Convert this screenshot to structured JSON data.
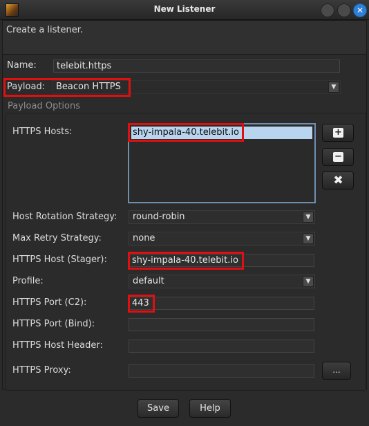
{
  "window": {
    "title": "New Listener",
    "close_glyph": "✕"
  },
  "header": {
    "description": "Create a listener."
  },
  "form": {
    "name_label": "Name:",
    "name_value": "telebit.https",
    "payload_label": "Payload:",
    "payload_value": "Beacon HTTPS",
    "dropdown_glyph": "▼"
  },
  "options": {
    "group_title": "Payload Options",
    "https_hosts_label": "HTTPS Hosts:",
    "https_hosts": [
      "shy-impala-40.telebit.io"
    ],
    "add_glyph": "+",
    "remove_glyph": "−",
    "clear_glyph": "✖",
    "host_rotation_label": "Host Rotation Strategy:",
    "host_rotation_value": "round-robin",
    "max_retry_label": "Max Retry Strategy:",
    "max_retry_value": "none",
    "stager_label": "HTTPS Host (Stager):",
    "stager_value": "shy-impala-40.telebit.io",
    "profile_label": "Profile:",
    "profile_value": "default",
    "port_c2_label": "HTTPS Port (C2):",
    "port_c2_value": "443",
    "port_bind_label": "HTTPS Port (Bind):",
    "port_bind_value": "",
    "host_header_label": "HTTPS Host Header:",
    "host_header_value": "",
    "proxy_label": "HTTPS Proxy:",
    "proxy_value": "",
    "proxy_button_label": "..."
  },
  "footer": {
    "save_label": "Save",
    "help_label": "Help"
  },
  "colors": {
    "highlight": "#e01010",
    "selection": "#b8d4ee",
    "close_button": "#2f7fd6"
  }
}
